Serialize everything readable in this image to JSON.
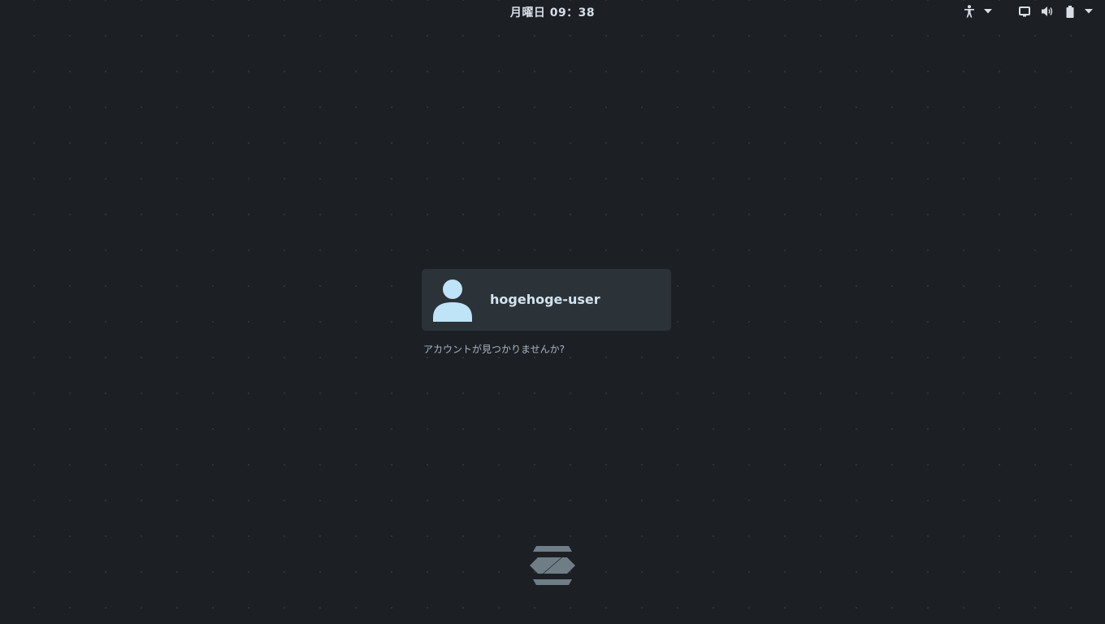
{
  "panel": {
    "clock": "月曜日 09：38",
    "tray_icons": [
      "accessibility-icon",
      "chevron-down-icon",
      "display-icon",
      "volume-icon",
      "battery-icon",
      "chevron-down-icon"
    ]
  },
  "login": {
    "user_name": "hogehoge-user",
    "not_listed_label": "アカウントが見つかりませんか?"
  },
  "branding": {
    "logo": "zorin-logo"
  },
  "colors": {
    "background": "#1c2025",
    "card": "#2b3238",
    "avatar": "#bfe3f7",
    "logo": "#6f7d86",
    "text": "#d8dee4"
  }
}
